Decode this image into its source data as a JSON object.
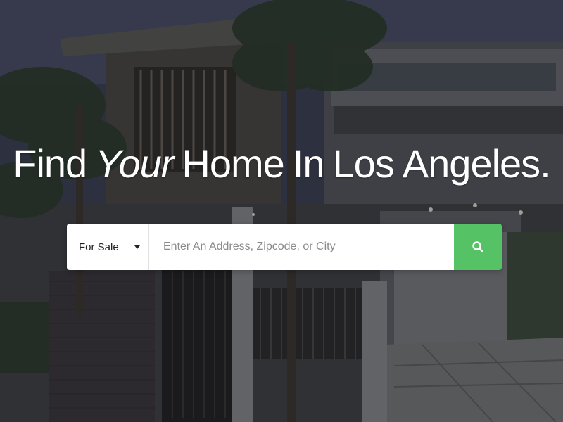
{
  "hero": {
    "headline_words": [
      "Find",
      "Your",
      "Home",
      "In",
      "Los",
      "Angeles."
    ]
  },
  "search": {
    "listing_type": "For Sale",
    "placeholder": "Enter An Address, Zipcode, or City",
    "button_icon": "search-icon"
  },
  "colors": {
    "accent": "#55c266",
    "overlay": "#14181c"
  }
}
